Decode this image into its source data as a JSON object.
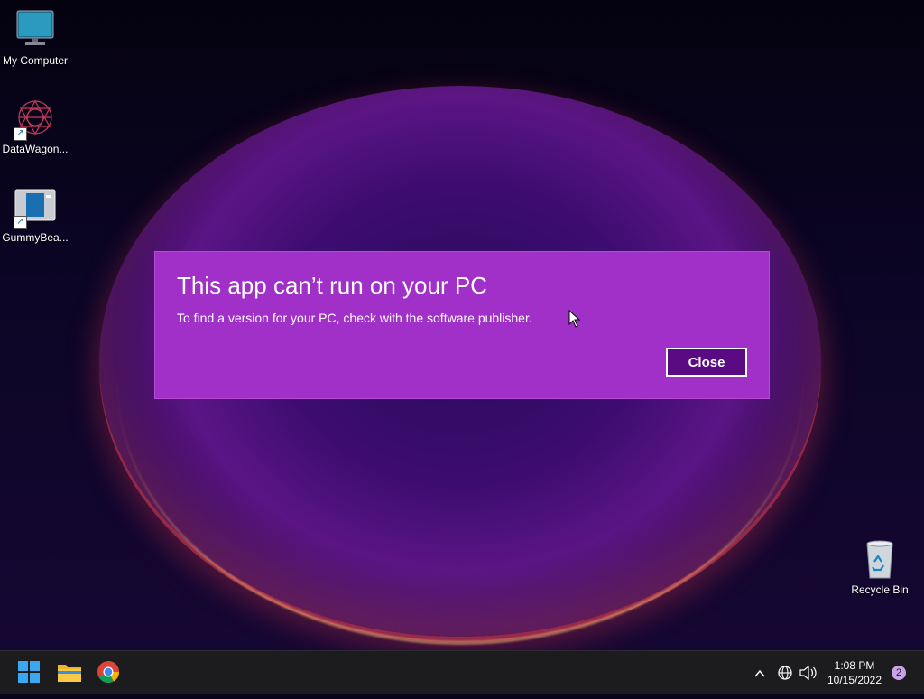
{
  "desktop": {
    "icons": [
      {
        "label": "My Computer",
        "icon": "monitor-icon"
      },
      {
        "label": "DataWagon...",
        "icon": "datawagon-app-icon"
      },
      {
        "label": "GummyBea...",
        "icon": "gummybear-app-icon"
      },
      {
        "label": "Recycle Bin",
        "icon": "recycle-bin-icon"
      }
    ]
  },
  "dialog": {
    "title": "This app can’t run on your PC",
    "message": "To find a version for your PC, check with the software publisher.",
    "close_label": "Close",
    "background": "#a030c8",
    "button_color": "#5a0a82"
  },
  "taskbar": {
    "pinned": [
      {
        "icon": "windows-start-icon"
      },
      {
        "icon": "file-explorer-icon"
      },
      {
        "icon": "chrome-icon"
      }
    ],
    "tray": {
      "time": "1:08 PM",
      "date": "10/15/2022",
      "notification_count": "2"
    }
  }
}
